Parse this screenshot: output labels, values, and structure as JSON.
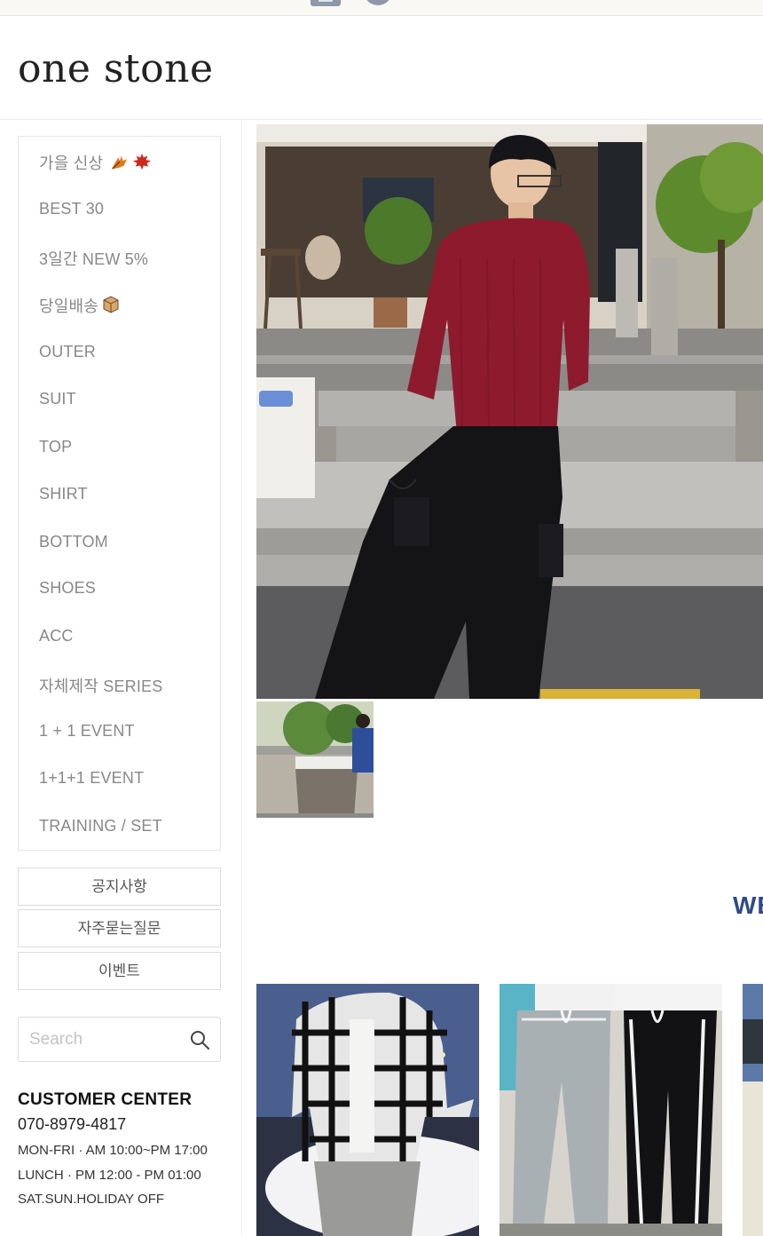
{
  "brand": {
    "logo_text": "one stone"
  },
  "menu": {
    "items": [
      {
        "label": "가을 신상",
        "icon": "maple-leaf-icon"
      },
      {
        "label": "BEST 30"
      },
      {
        "label": "3일간 NEW 5%"
      },
      {
        "label": "당일배송",
        "icon": "package-box-icon"
      },
      {
        "label": "OUTER"
      },
      {
        "label": "SUIT"
      },
      {
        "label": "TOP"
      },
      {
        "label": "SHIRT"
      },
      {
        "label": "BOTTOM"
      },
      {
        "label": "SHOES"
      },
      {
        "label": "ACC"
      },
      {
        "label": "자체제작 SERIES"
      },
      {
        "label": "1 + 1 EVENT"
      },
      {
        "label": "1+1+1 EVENT"
      },
      {
        "label": "TRAINING / SET"
      }
    ]
  },
  "side_buttons": {
    "notice": "공지사항",
    "faq": "자주묻는질문",
    "event": "이벤트"
  },
  "search": {
    "placeholder": "Search",
    "icon": "search-icon"
  },
  "customer_center": {
    "title": "CUSTOMER CENTER",
    "phone": "070-8979-4817",
    "hours": "MON-FRI · AM 10:00~PM 17:00",
    "lunch": "LUNCH · PM 12:00 - PM 01:00",
    "holiday": "SAT.SUN.HOLIDAY OFF"
  },
  "section": {
    "partial_heading": "WE"
  },
  "colors": {
    "accent_blue": "#2e4a8b",
    "menu_text": "#888888",
    "border": "#e6e6e6",
    "sweater_red": "#8e1a2e"
  }
}
